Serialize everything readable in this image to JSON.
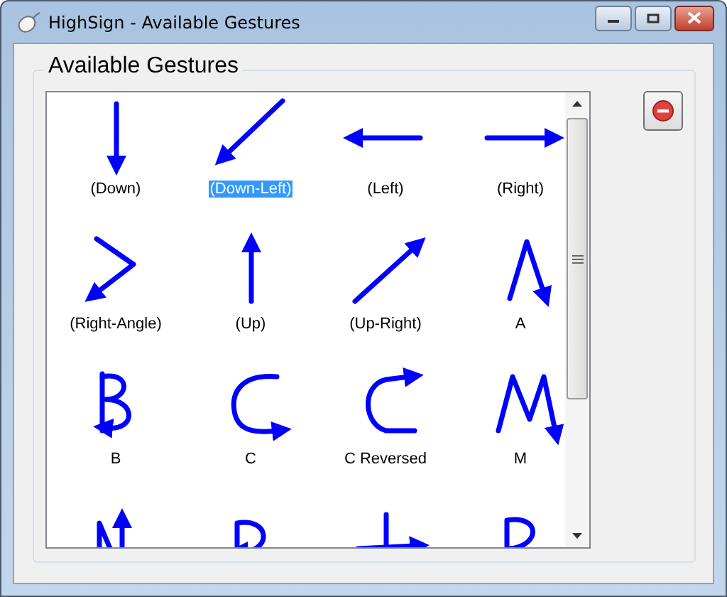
{
  "window": {
    "title": "HighSign - Available Gestures"
  },
  "group": {
    "title": "Available Gestures"
  },
  "gestures": [
    {
      "label": "(Down)",
      "selected": false
    },
    {
      "label": "(Down-Left)",
      "selected": true
    },
    {
      "label": "(Left)",
      "selected": false
    },
    {
      "label": "(Right)",
      "selected": false
    },
    {
      "label": "(Right-Angle)",
      "selected": false
    },
    {
      "label": "(Up)",
      "selected": false
    },
    {
      "label": "(Up-Right)",
      "selected": false
    },
    {
      "label": "A",
      "selected": false
    },
    {
      "label": "B",
      "selected": false
    },
    {
      "label": "C",
      "selected": false
    },
    {
      "label": "C Reversed",
      "selected": false
    },
    {
      "label": "M",
      "selected": false
    },
    {
      "selected": false
    },
    {
      "selected": false
    },
    {
      "selected": false
    },
    {
      "selected": false
    }
  ]
}
